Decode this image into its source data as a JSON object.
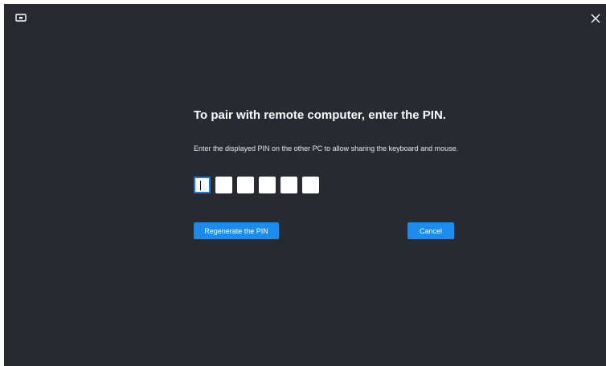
{
  "window": {
    "app_icon": "monitor-icon",
    "close_icon": "close-icon"
  },
  "dialog": {
    "title": "To pair with remote computer, enter the PIN.",
    "subtitle": "Enter the displayed PIN on the other PC to allow sharing the keyboard and mouse.",
    "pin_digits": [
      "",
      "",
      "",
      "",
      "",
      ""
    ],
    "regenerate_label": "Regenerate the PIN",
    "cancel_label": "Cancel"
  },
  "colors": {
    "background": "#272b31",
    "accent": "#1a8cf0",
    "text": "#ffffff"
  }
}
